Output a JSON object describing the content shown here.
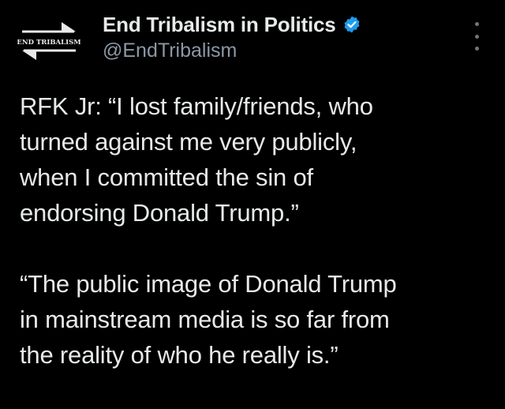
{
  "author": {
    "display_name": "End Tribalism in Politics",
    "handle": "@EndTribalism",
    "avatar_text": "END TRIBALISM",
    "verified_color": "#1d9bf0"
  },
  "more_icon": "more-horizontal-icon",
  "tweet": {
    "paragraphs": [
      "RFK Jr: “I lost family/friends, who\nturned against me very publicly,\nwhen I committed the sin of\nendorsing Donald Trump.”",
      "“The public image of Donald Trump\nin mainstream media is so far from\nthe reality of who he really is.”"
    ]
  },
  "colors": {
    "background": "#000000",
    "text": "#e7e9ea",
    "secondary_text": "#8b98a5"
  }
}
